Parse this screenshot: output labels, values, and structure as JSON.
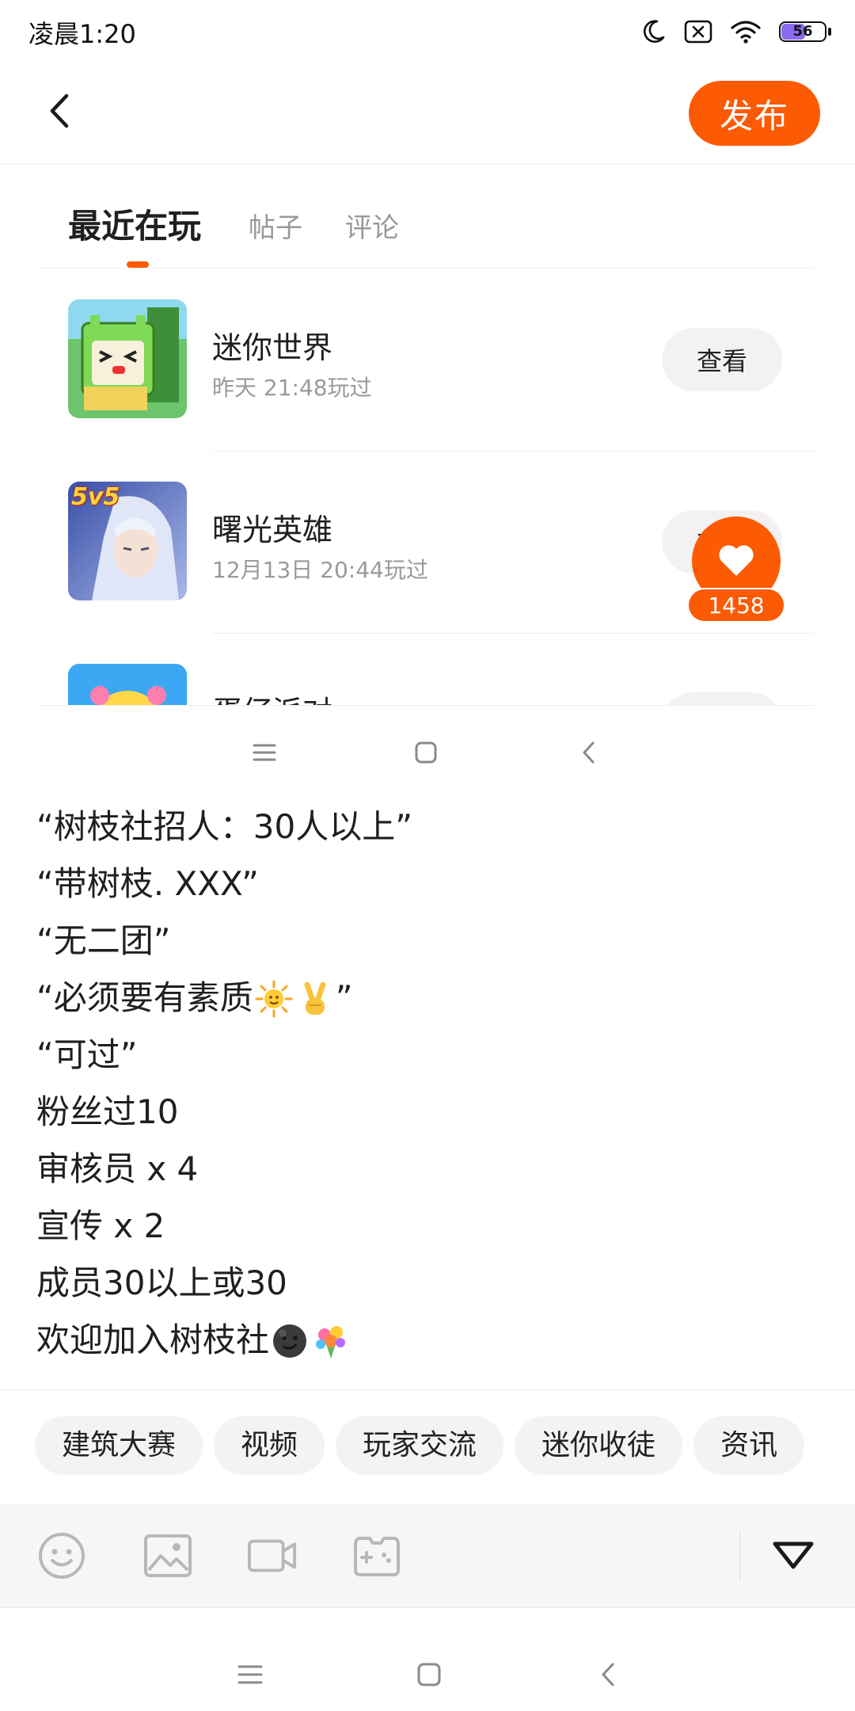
{
  "status_bar": {
    "time": "凌晨1:20",
    "battery_level": "56",
    "icons": [
      "moon-icon",
      "sim-x-icon",
      "wifi-icon",
      "battery-icon"
    ]
  },
  "header": {
    "back_icon": "chevron-left-icon",
    "publish_label": "发布",
    "accent_color": "#fc5a03"
  },
  "tabs": [
    {
      "label": "最近在玩",
      "active": true
    },
    {
      "label": "帖子",
      "active": false
    },
    {
      "label": "评论",
      "active": false
    }
  ],
  "games": [
    {
      "name": "迷你世界",
      "played": "昨天 21:48玩过",
      "action": "查看"
    },
    {
      "name": "曙光英雄",
      "played": "12月13日 20:44玩过",
      "action": "查看",
      "icon_badge": "5v5"
    },
    {
      "name": "蛋仔派对",
      "played": "",
      "action": "查看"
    }
  ],
  "like_float": {
    "count": "1458"
  },
  "post": {
    "lines": [
      "“树枝社招人：30人以上”",
      "“带树枝. XXX”",
      "“无二团”",
      "“必须要有素质",
      "“可过”",
      "粉丝过10",
      "审核员 x 4",
      "宣传 x 2",
      "成员30以上或30",
      "欢迎加入树枝社"
    ],
    "line4_tail": "”",
    "emojis": [
      "sun-emoji",
      "victory-hand-emoji",
      "smirk-moon-emoji",
      "bouquet-emoji"
    ]
  },
  "topic_tags": [
    "建筑大赛",
    "视频",
    "玩家交流",
    "迷你收徒",
    "资讯"
  ],
  "toolbar": {
    "icons": [
      "emoji-icon",
      "image-icon",
      "video-icon",
      "gamepad-icon",
      "collapse-triangle-icon"
    ]
  },
  "system_nav": [
    "menu-icon",
    "home-icon",
    "back-icon"
  ]
}
